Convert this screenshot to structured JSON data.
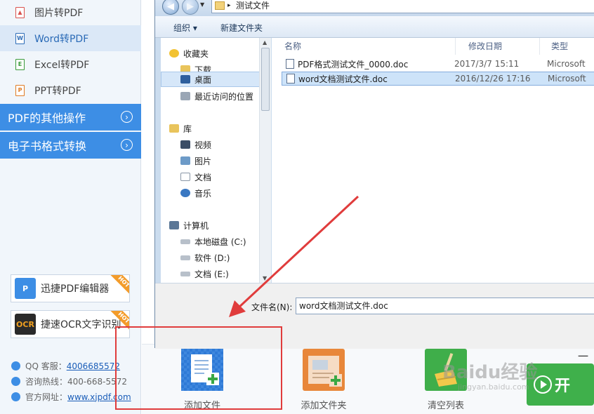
{
  "sidebar": {
    "items": [
      {
        "label": "图片转PDF",
        "icon": "image-doc-icon",
        "color": "#d9534f"
      },
      {
        "label": "Word转PDF",
        "icon": "word-doc-icon",
        "color": "#2b6bb7",
        "active": true
      },
      {
        "label": "Excel转PDF",
        "icon": "excel-doc-icon",
        "color": "#3a9a3a"
      },
      {
        "label": "PPT转PDF",
        "icon": "ppt-doc-icon",
        "color": "#e07b24"
      }
    ],
    "sections": [
      {
        "label": "PDF的其他操作"
      },
      {
        "label": "电子书格式转换"
      }
    ],
    "promos": [
      {
        "label": "迅捷PDF编辑器",
        "badge": "HOT",
        "logo_color": "#3d8ee5"
      },
      {
        "label": "捷速OCR文字识别",
        "badge": "HOT",
        "logo_color": "#e0a020",
        "logo_text": "OCR"
      }
    ],
    "contact": {
      "qq_label": "QQ 客服：",
      "qq_value": "4006685572",
      "phone_label": "咨询热线：",
      "phone_value": "400-668-5572",
      "site_label": "官方网址：",
      "site_value": "www.xjpdf.com"
    }
  },
  "dialog": {
    "path": "测试文件",
    "toolbar": {
      "organize": "组织 ▾",
      "new_folder": "新建文件夹"
    },
    "nav": [
      {
        "label": "收藏夹",
        "icon": "star-icon",
        "level": 0
      },
      {
        "label": "下载",
        "icon": "download-folder-icon",
        "level": 1
      },
      {
        "label": "桌面",
        "icon": "desktop-icon",
        "level": 1,
        "selected": true
      },
      {
        "label": "最近访问的位置",
        "icon": "recent-places-icon",
        "level": 1
      },
      {
        "label": "库",
        "icon": "library-icon",
        "level": 0
      },
      {
        "label": "视频",
        "icon": "video-icon",
        "level": 1
      },
      {
        "label": "图片",
        "icon": "pictures-icon",
        "level": 1
      },
      {
        "label": "文档",
        "icon": "documents-icon",
        "level": 1
      },
      {
        "label": "音乐",
        "icon": "music-icon",
        "level": 1
      },
      {
        "label": "计算机",
        "icon": "computer-icon",
        "level": 0
      },
      {
        "label": "本地磁盘 (C:)",
        "icon": "drive-icon",
        "level": 1
      },
      {
        "label": "软件 (D:)",
        "icon": "drive-icon",
        "level": 1
      },
      {
        "label": "文档 (E:)",
        "icon": "drive-icon",
        "level": 1
      }
    ],
    "columns": {
      "name": "名称",
      "date": "修改日期",
      "type": "类型"
    },
    "files": [
      {
        "name": "PDF格式测试文件_0000.doc",
        "date": "2017/3/7 15:11",
        "type": "Microsoft"
      },
      {
        "name": "word文档测试文件.doc",
        "date": "2016/12/26 17:16",
        "type": "Microsoft",
        "selected": true
      }
    ],
    "filename_label": "文件名(N):",
    "filename_value": "word文档测试文件.doc"
  },
  "tools": [
    {
      "label": "添加文件",
      "icon": "add-file-icon"
    },
    {
      "label": "添加文件夹",
      "icon": "add-folder-icon"
    },
    {
      "label": "清空列表",
      "icon": "clear-list-icon"
    }
  ],
  "start_button": {
    "label": "开"
  },
  "corner_text": "一",
  "watermark": {
    "text": "Baidu经验",
    "sub": "jingyan.baidu.com"
  },
  "accent_color": "#3d8ee5",
  "annotation_color": "#e03c3c"
}
